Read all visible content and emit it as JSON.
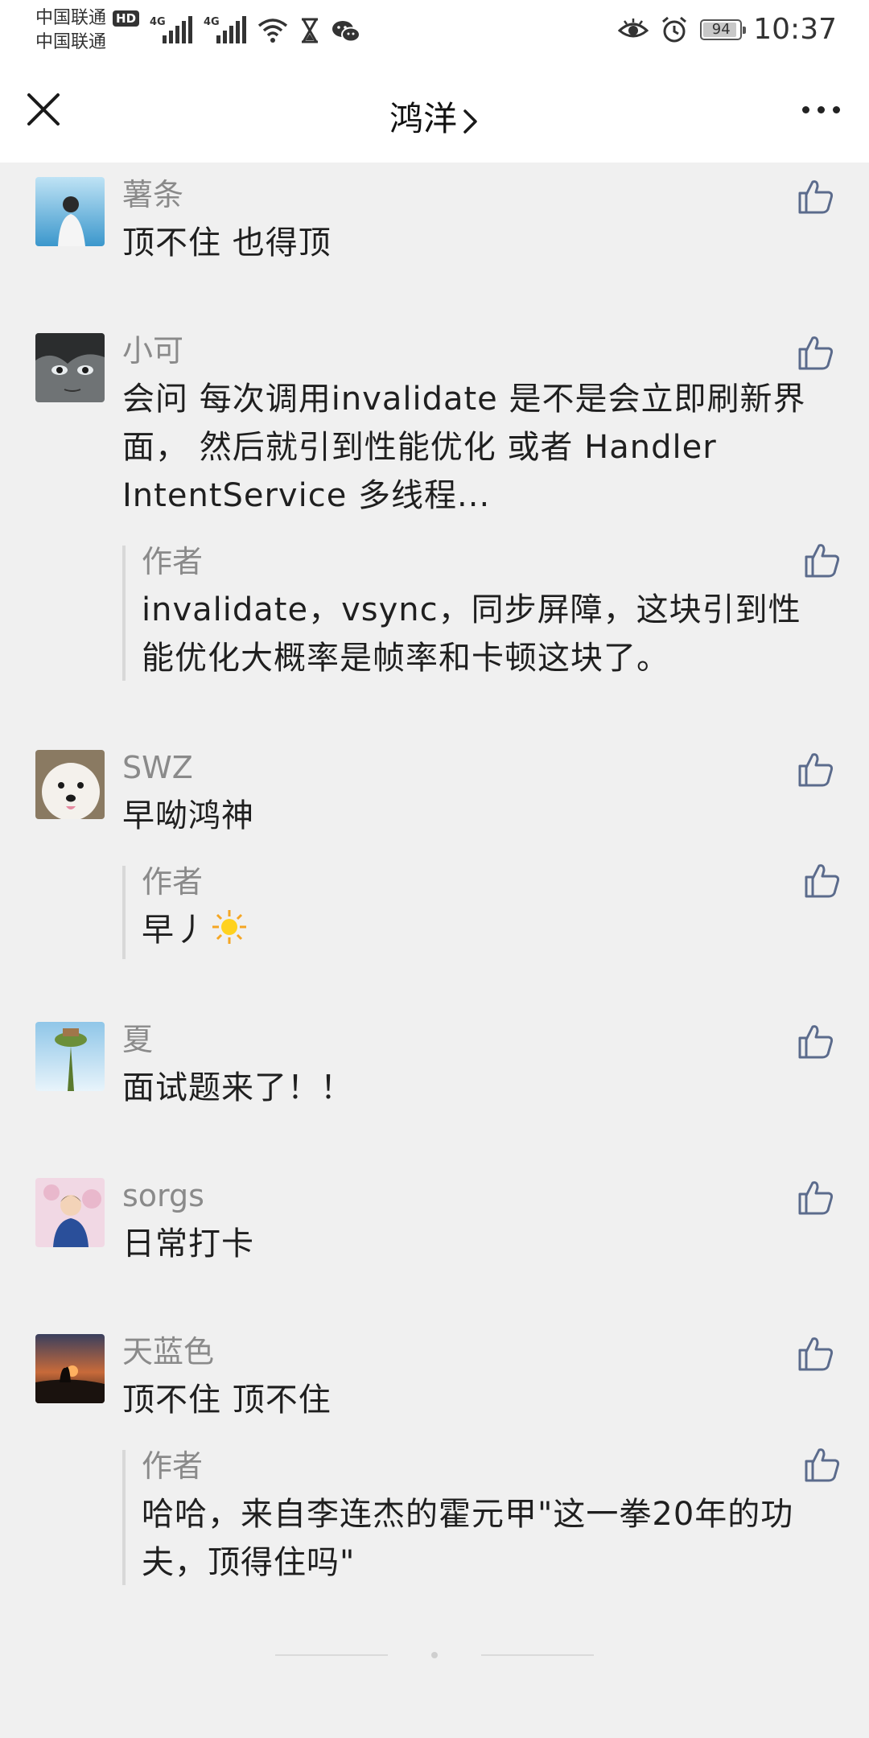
{
  "status_bar": {
    "carrier_1": "中国联通",
    "carrier_1_badge": "HD",
    "carrier_2": "中国联通",
    "network_label_1": "4G",
    "network_label_2": "4G",
    "battery_percent": "94",
    "time": "10:37"
  },
  "header": {
    "title": "鸿洋",
    "close_icon": "close-icon",
    "more_icon": "more-icon"
  },
  "comments": [
    {
      "nickname": "薯条",
      "text": "顶不住 也得顶"
    },
    {
      "nickname": "小可",
      "text": "会问 每次调用invalidate  是不是会立即刷新界面，  然后就引到性能优化    或者 Handler IntentService  多线程...",
      "reply": {
        "author": "作者",
        "text": "invalidate，vsync，同步屏障，这块引到性能优化大概率是帧率和卡顿这块了。"
      }
    },
    {
      "nickname": "SWZ",
      "text": "早呦鸿神",
      "reply": {
        "author": "作者",
        "text": "早丿"
      }
    },
    {
      "nickname": "夏",
      "text": "面试题来了！！"
    },
    {
      "nickname": "sorgs",
      "text": "日常打卡"
    },
    {
      "nickname": "天蓝色",
      "text": "顶不住 顶不住",
      "reply": {
        "author": "作者",
        "text": "哈哈，来自李连杰的霍元甲\"这一拳20年的功夫，顶得住吗\""
      }
    }
  ],
  "colors": {
    "background": "#f0f0f0",
    "header_bg": "#ffffff",
    "nickname": "#8a8a8a",
    "body_text": "#1f1f1f",
    "like_icon": "#5b6b8c"
  }
}
